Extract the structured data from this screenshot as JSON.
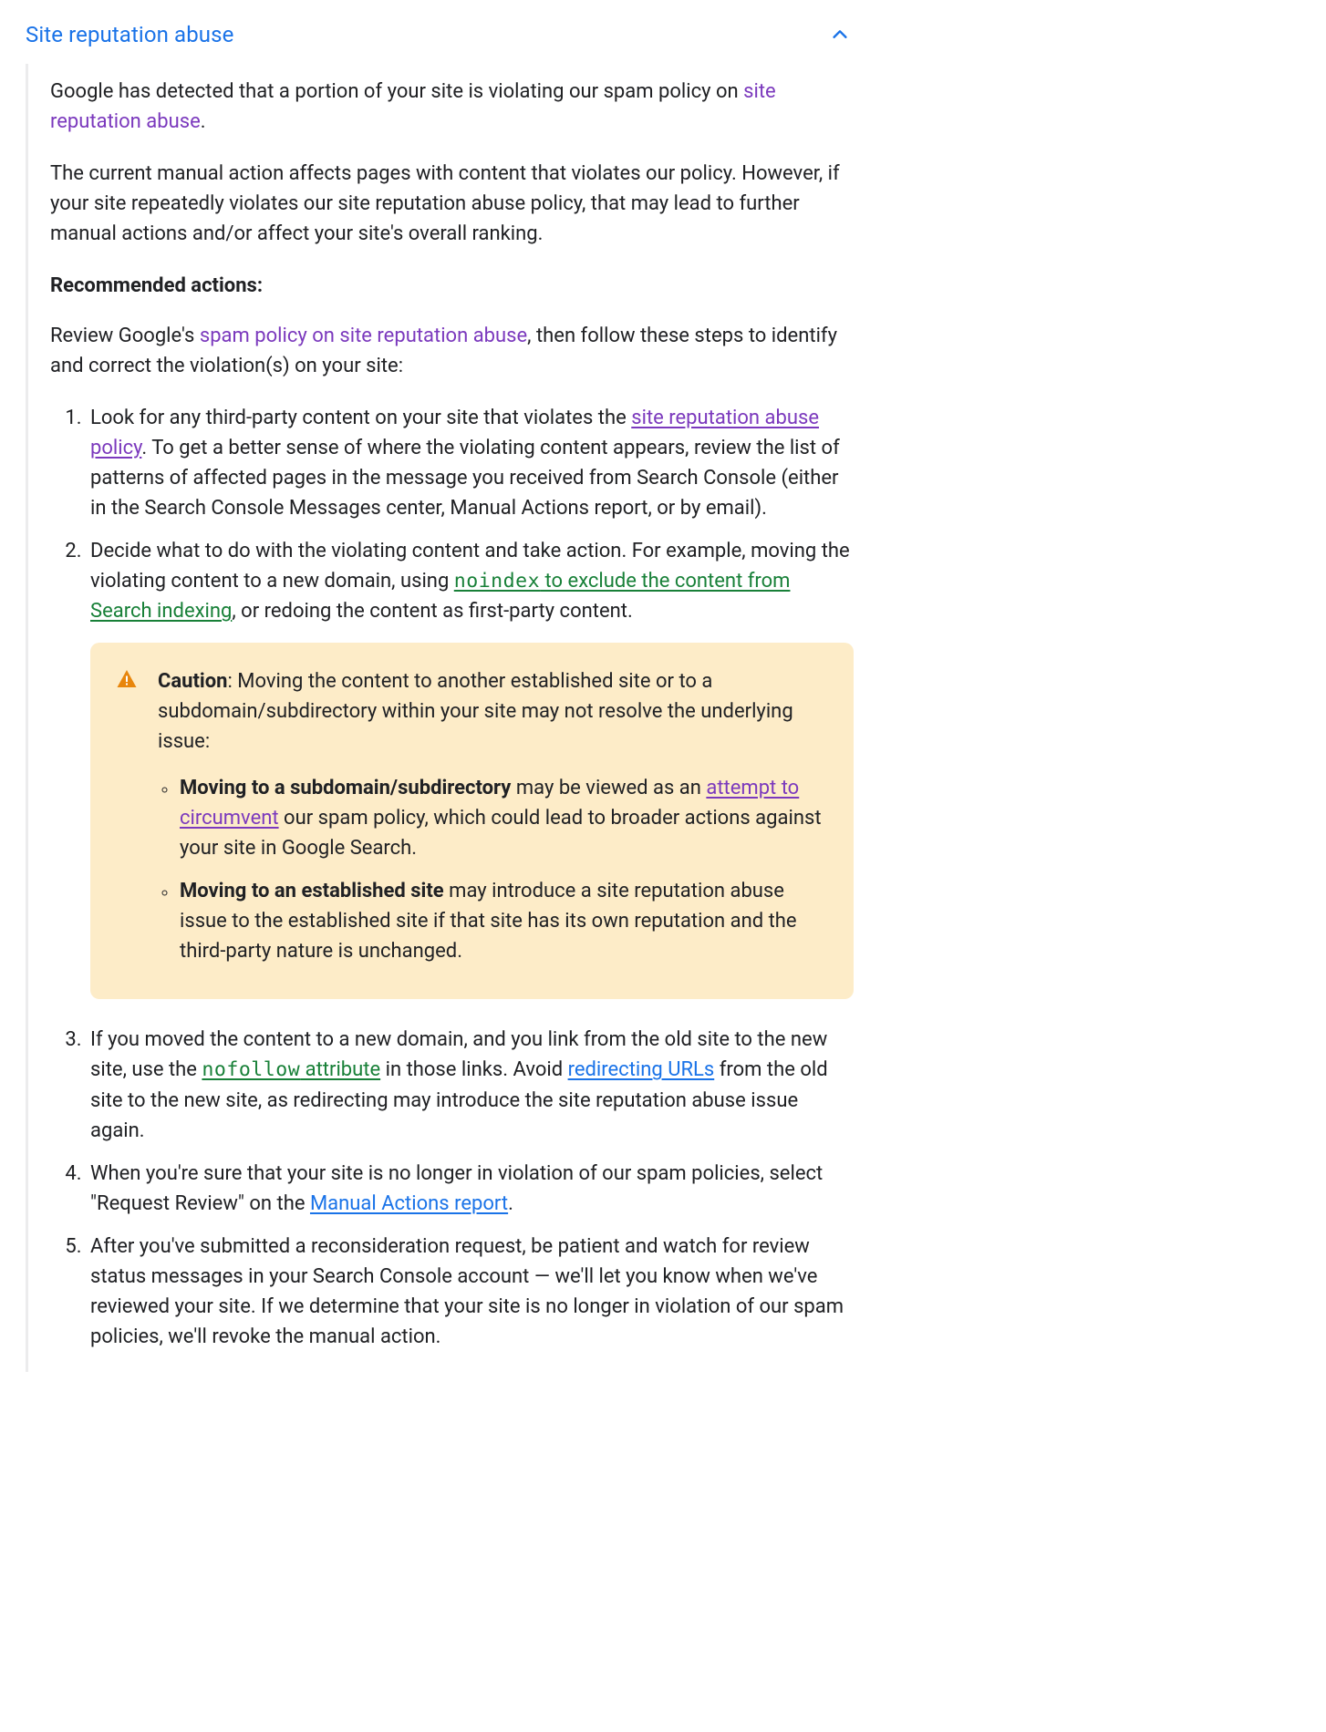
{
  "header": {
    "title": "Site reputation abuse"
  },
  "intro": {
    "p1_prefix": "Google has detected that a portion of your site is violating our spam policy on ",
    "p1_link": "site reputation abuse",
    "p1_suffix": ".",
    "p2": "The current manual action affects pages with content that violates our policy. However, if your site repeatedly violates our site reputation abuse policy, that may lead to further manual actions and/or affect your site's overall ranking."
  },
  "rec": {
    "heading": "Recommended actions:",
    "lead_prefix": "Review Google's ",
    "lead_link": "spam policy on site reputation abuse",
    "lead_suffix": ", then follow these steps to identify and correct the violation(s) on your site:"
  },
  "steps": {
    "s1": {
      "t1": "Look for any third-party content on your site that violates the ",
      "link": "site reputation abuse policy",
      "t2": ". To get a better sense of where the violating content appears, review the list of patterns of affected pages in the message you received from Search Console (either in the Search Console Messages center, Manual Actions report, or by email)."
    },
    "s2": {
      "t1": "Decide what to do with the violating content and take action. For example, moving the violating content to a new domain, using ",
      "link_code": "noindex",
      "link_rest": " to exclude the content from Search indexing",
      "t2": ", or redoing the content as first-party content."
    },
    "caution": {
      "title": "Caution",
      "intro": ": Moving the content to another established site or to a subdomain/subdirectory within your site may not resolve the underlying issue:",
      "b1": {
        "strong": "Moving to a subdomain/subdirectory",
        "mid": " may be viewed as an ",
        "link": "attempt to circumvent",
        "after": " our spam policy, which could lead to broader actions against your site in Google Search."
      },
      "b2": {
        "strong": "Moving to an established site",
        "after": " may introduce a site reputation abuse issue to the established site if that site has its own reputation and the third-party nature is unchanged."
      }
    },
    "s3": {
      "t1": "If you moved the content to a new domain, and you link from the old site to the new site, use the ",
      "link1_code": "nofollow",
      "link1_rest": " attribute",
      "t2": " in those links. Avoid ",
      "link2": "redirecting URLs",
      "t3": " from the old site to the new site, as redirecting may introduce the site reputation abuse issue again."
    },
    "s4": {
      "t1": "When you're sure that your site is no longer in violation of our spam policies, select \"Request Review\" on the ",
      "link": "Manual Actions report",
      "t2": "."
    },
    "s5": {
      "t1": "After you've submitted a reconsideration request, be patient and watch for review status messages in your Search Console account — we'll let you know when we've reviewed your site. If we determine that your site is no longer in violation of our spam policies, we'll revoke the manual action."
    }
  }
}
